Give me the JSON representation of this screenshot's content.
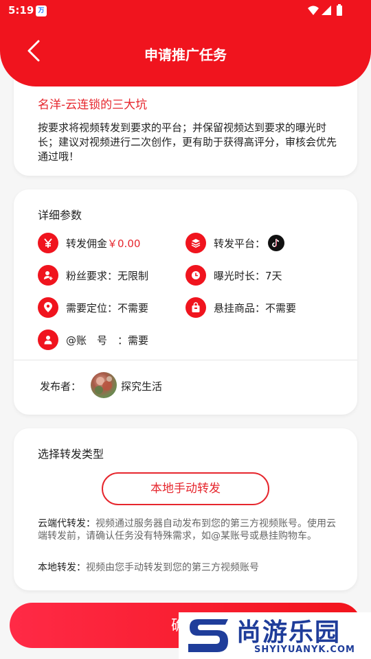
{
  "status_bar": {
    "time": "5:19",
    "app_badge": "万"
  },
  "header": {
    "title": "申请推广任务"
  },
  "task": {
    "name": "名洋-云连锁的三大坑",
    "description": "按要求将视频转发到要求的平台；并保留视频达到要求的曝光时长；建议对视频进行二次创作，更有助于获得高评分，审核会优先通过哦！"
  },
  "params": {
    "title": "详细参数",
    "commission_label": "转发佣金",
    "commission_value": "￥0.00",
    "platform_label": "转发平台：",
    "fans_label": "粉丝要求：",
    "fans_value": "无限制",
    "exposure_label": "曝光时长：",
    "exposure_value": "7天",
    "location_label": "需要定位：",
    "location_value": "不需要",
    "goods_label": "悬挂商品：",
    "goods_value": "不需要",
    "at_label": "@账　号　：",
    "at_value": "需要"
  },
  "publisher": {
    "label": "发布者：",
    "name": "探究生活"
  },
  "forward_type": {
    "title": "选择转发类型",
    "selected_option": "本地手动转发",
    "cloud_label": "云端代转发：",
    "cloud_desc": "视频通过服务器自动发布到您的第三方视频账号。使用云端转发前，请确认任务没有特殊需求，如@某账号或悬挂购物车。",
    "local_label": "本地转发：",
    "local_desc": "视频由您手动转发到您的第三方视频账号"
  },
  "confirm": {
    "label": "确认"
  },
  "watermark": {
    "brand": "尚游乐园",
    "url": "SHYIYUANYK.COM"
  },
  "colors": {
    "primary": "#f0141e",
    "accent_text": "#e6262d"
  }
}
